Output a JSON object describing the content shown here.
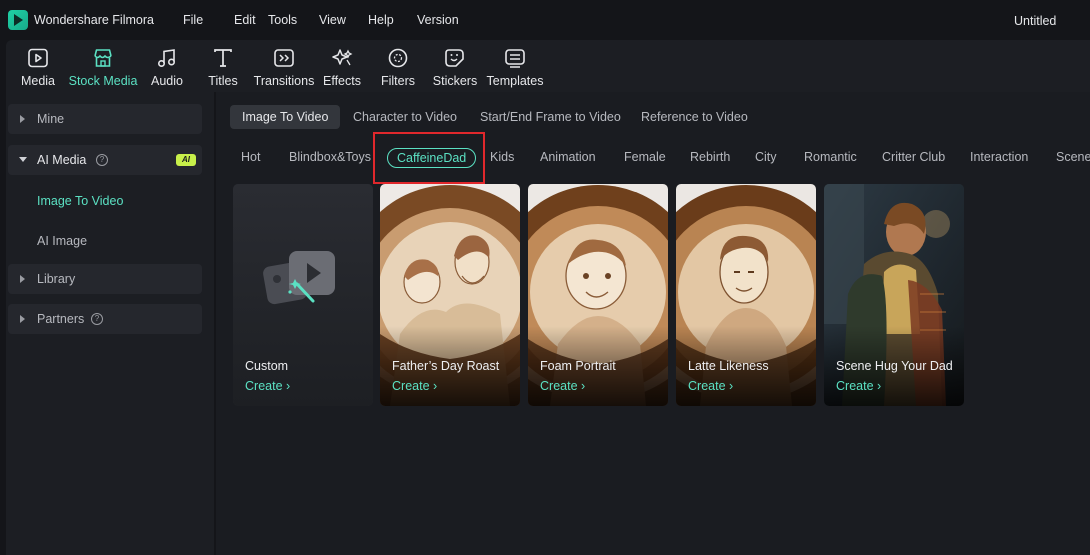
{
  "app": {
    "name": "Wondershare Filmora",
    "doc_title": "Untitled",
    "accent": "#5be1c3"
  },
  "menu": [
    "File",
    "Edit",
    "Tools",
    "View",
    "Help",
    "Version"
  ],
  "toolbar": [
    {
      "label": "Media",
      "icon": "media-icon"
    },
    {
      "label": "Stock Media",
      "icon": "stock-media-icon",
      "active": true
    },
    {
      "label": "Audio",
      "icon": "music-note-icon"
    },
    {
      "label": "Titles",
      "icon": "text-t-icon"
    },
    {
      "label": "Transitions",
      "icon": "transitions-icon"
    },
    {
      "label": "Effects",
      "icon": "effects-sparkle-icon"
    },
    {
      "label": "Filters",
      "icon": "filters-icon"
    },
    {
      "label": "Stickers",
      "icon": "sticker-icon"
    },
    {
      "label": "Templates",
      "icon": "templates-icon"
    }
  ],
  "sidebar": {
    "mine": "Mine",
    "ai_media": "AI Media",
    "ai_badge": "AI",
    "image_to_video": "Image To Video",
    "ai_image": "AI Image",
    "library": "Library",
    "partners": "Partners"
  },
  "tabs": [
    "Image To Video",
    "Character to Video",
    "Start/End Frame to Video",
    "Reference to Video"
  ],
  "categories": [
    "Hot",
    "Blindbox&Toys",
    "CaffeineDad",
    "Kids",
    "Animation",
    "Female",
    "Rebirth",
    "City",
    "Romantic",
    "Critter Club",
    "Interaction",
    "Scener"
  ],
  "active_category": "CaffeineDad",
  "cards": [
    {
      "title": "Custom",
      "action": "Create"
    },
    {
      "title": "Father’s Day Roast",
      "action": "Create"
    },
    {
      "title": "Foam Portrait",
      "action": "Create"
    },
    {
      "title": "Latte Likeness",
      "action": "Create"
    },
    {
      "title": "Scene Hug Your Dad",
      "action": "Create"
    }
  ]
}
